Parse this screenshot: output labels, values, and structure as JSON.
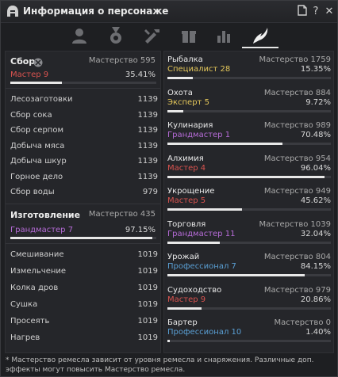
{
  "window": {
    "title": "Информация о персонаже",
    "icon": "warrior-helmet-icon"
  },
  "titlebar_buttons": [
    {
      "name": "document-icon",
      "glyph": "🗎"
    },
    {
      "name": "help-icon",
      "glyph": "?"
    },
    {
      "name": "close-icon",
      "glyph": "✕"
    }
  ],
  "tabs": [
    {
      "name": "tab-character",
      "icon": "person-icon",
      "active": false
    },
    {
      "name": "tab-medal",
      "icon": "medal-icon",
      "active": false
    },
    {
      "name": "tab-tools",
      "icon": "tools-icon",
      "active": false
    },
    {
      "name": "tab-gift",
      "icon": "gift-icon",
      "active": false
    },
    {
      "name": "tab-stats",
      "icon": "bar-chart-icon",
      "active": false
    },
    {
      "name": "tab-life-skills",
      "icon": "life-skill-icon",
      "active": true
    }
  ],
  "left": {
    "gather": {
      "title": "Сбор",
      "mastery": "Мастерство 595",
      "grade": "Мастер 9",
      "grade_color": "red",
      "percent": "35.41%",
      "fill": 0.3541,
      "rows": [
        {
          "label": "Лесозаготовки",
          "value": "1139"
        },
        {
          "label": "Сбор сока",
          "value": "1139"
        },
        {
          "label": "Сбор серпом",
          "value": "1139"
        },
        {
          "label": "Добыча мяса",
          "value": "1139"
        },
        {
          "label": "Добыча шкур",
          "value": "1139"
        },
        {
          "label": "Горное дело",
          "value": "1139"
        },
        {
          "label": "Сбор воды",
          "value": "979"
        }
      ]
    },
    "craft": {
      "title": "Изготовление",
      "mastery": "Мастерство 435",
      "grade": "Грандмастер 7",
      "grade_color": "purple",
      "percent": "97.15%",
      "fill": 0.9715,
      "rows": [
        {
          "label": "Смешивание",
          "value": "1019"
        },
        {
          "label": "Измельчение",
          "value": "1019"
        },
        {
          "label": "Колка дров",
          "value": "1019"
        },
        {
          "label": "Сушка",
          "value": "1019"
        },
        {
          "label": "Просеять",
          "value": "1019"
        },
        {
          "label": "Нагрев",
          "value": "1019"
        }
      ]
    }
  },
  "right": {
    "skills": [
      {
        "name": "Рыбалка",
        "mastery": "Мастерство 1759",
        "grade": "Специалист 28",
        "grade_color": "yellow",
        "percent": "15.35%",
        "fill": 0.1535
      },
      {
        "name": "Охота",
        "mastery": "Мастерство 884",
        "grade": "Эксперт 5",
        "grade_color": "yellow",
        "percent": "9.72%",
        "fill": 0.0972
      },
      {
        "name": "Кулинария",
        "mastery": "Мастерство 989",
        "grade": "Грандмастер 1",
        "grade_color": "purple",
        "percent": "70.48%",
        "fill": 0.7048
      },
      {
        "name": "Алхимия",
        "mastery": "Мастерство 954",
        "grade": "Мастер 4",
        "grade_color": "red",
        "percent": "96.04%",
        "fill": 0.9604
      },
      {
        "name": "Укрощение",
        "mastery": "Мастерство 949",
        "grade": "Мастер 5",
        "grade_color": "red",
        "percent": "45.62%",
        "fill": 0.4562
      },
      {
        "name": "Торговля",
        "mastery": "Мастерство 1039",
        "grade": "Грандмастер 11",
        "grade_color": "purple",
        "percent": "32.04%",
        "fill": 0.3204
      },
      {
        "name": "Урожай",
        "mastery": "Мастерство 804",
        "grade": "Профессионал 7",
        "grade_color": "blue",
        "percent": "84.15%",
        "fill": 0.8415
      },
      {
        "name": "Судоходство",
        "mastery": "Мастерство 979",
        "grade": "Мастер 9",
        "grade_color": "red",
        "percent": "20.86%",
        "fill": 0.2086
      },
      {
        "name": "Бартер",
        "mastery": "Мастерство 0",
        "grade": "Профессионал 10",
        "grade_color": "blue",
        "percent": "1.40%",
        "fill": 0.014
      }
    ]
  },
  "footnote": "* Мастерство ремесла зависит от уровня ремесла и снаряжения. Различные доп. эффекты могут повысить Мастерство ремесла."
}
